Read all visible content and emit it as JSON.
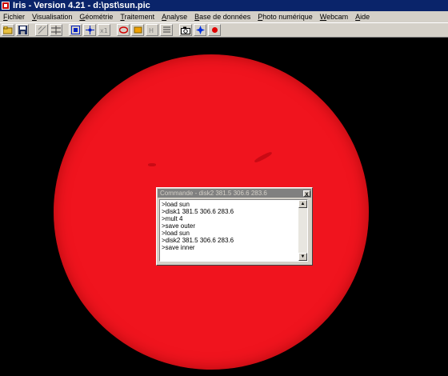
{
  "window": {
    "title": "Iris - Version 4.21 - d:\\pst\\sun.pic"
  },
  "menu": {
    "items": [
      "Fichier",
      "Visualisation",
      "Géométrie",
      "Traitement",
      "Analyse",
      "Base de données",
      "Photo numérique",
      "Webcam",
      "Aide"
    ]
  },
  "toolbar": {
    "buttons": [
      "open-folder-icon",
      "save-disk-icon",
      "scale-icon",
      "threshold-icon",
      "zoom-box-icon",
      "crosshair-icon",
      "x1-icon",
      "red-ellipse-icon",
      "palette-icon",
      "h-icon",
      "list-icon",
      "camera-icon",
      "blue-star-icon",
      "record-red-dot-icon"
    ]
  },
  "colors": {
    "sun": "#f0141e",
    "background": "#000000",
    "titlebar": "#0a246a"
  },
  "command_window": {
    "title": "Commande - disk2 381.5 306.6 283.6",
    "close_label": "x",
    "lines": [
      ">load sun",
      ">disk1 381.5 306.6 283.6",
      ">mult 4",
      ">save outer",
      ">load sun",
      ">disk2 381.5 306.6 283.6",
      ">save inner"
    ]
  }
}
